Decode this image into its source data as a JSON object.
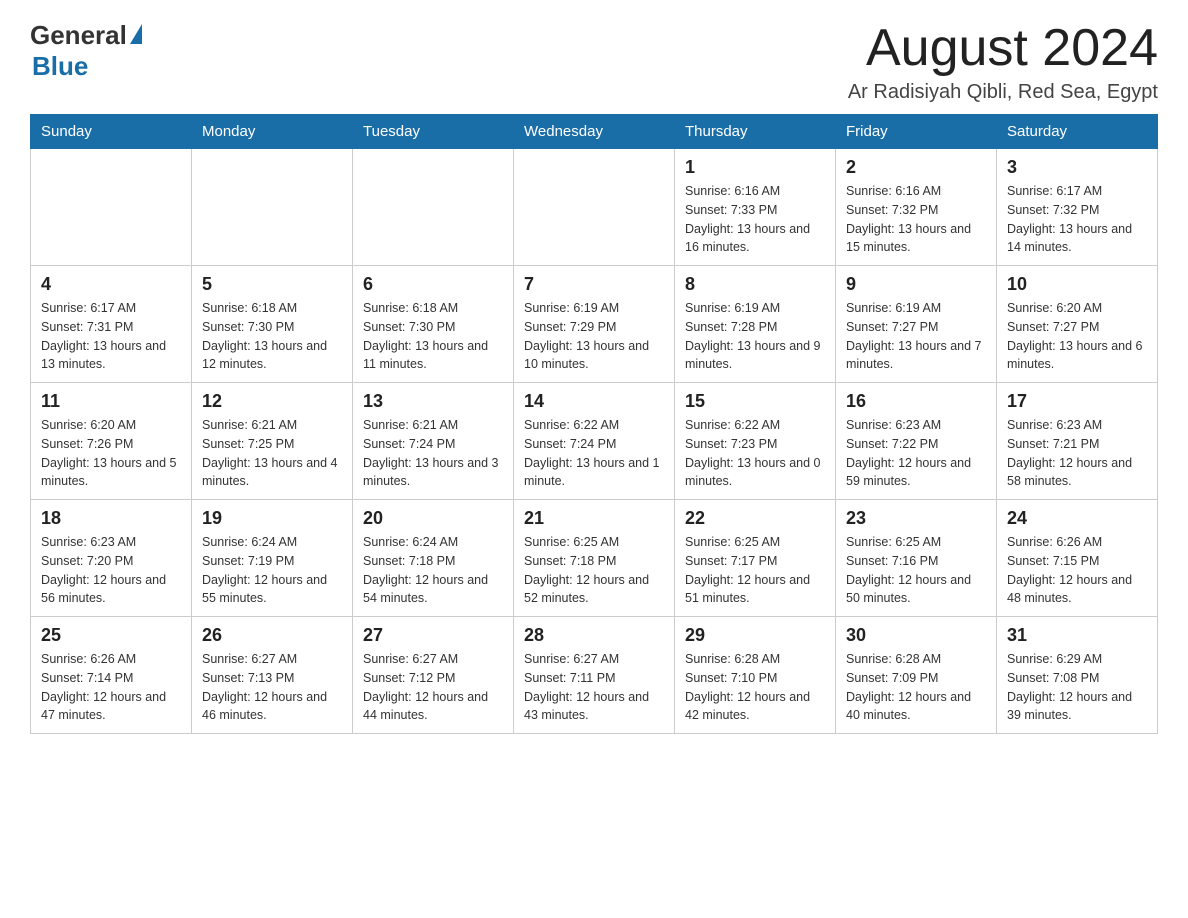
{
  "header": {
    "logo": {
      "general": "General",
      "blue": "Blue"
    },
    "title": "August 2024",
    "location": "Ar Radisiyah Qibli, Red Sea, Egypt"
  },
  "days_of_week": [
    "Sunday",
    "Monday",
    "Tuesday",
    "Wednesday",
    "Thursday",
    "Friday",
    "Saturday"
  ],
  "weeks": [
    [
      {
        "day": "",
        "sunrise": "",
        "sunset": "",
        "daylight": ""
      },
      {
        "day": "",
        "sunrise": "",
        "sunset": "",
        "daylight": ""
      },
      {
        "day": "",
        "sunrise": "",
        "sunset": "",
        "daylight": ""
      },
      {
        "day": "",
        "sunrise": "",
        "sunset": "",
        "daylight": ""
      },
      {
        "day": "1",
        "sunrise": "Sunrise: 6:16 AM",
        "sunset": "Sunset: 7:33 PM",
        "daylight": "Daylight: 13 hours and 16 minutes."
      },
      {
        "day": "2",
        "sunrise": "Sunrise: 6:16 AM",
        "sunset": "Sunset: 7:32 PM",
        "daylight": "Daylight: 13 hours and 15 minutes."
      },
      {
        "day": "3",
        "sunrise": "Sunrise: 6:17 AM",
        "sunset": "Sunset: 7:32 PM",
        "daylight": "Daylight: 13 hours and 14 minutes."
      }
    ],
    [
      {
        "day": "4",
        "sunrise": "Sunrise: 6:17 AM",
        "sunset": "Sunset: 7:31 PM",
        "daylight": "Daylight: 13 hours and 13 minutes."
      },
      {
        "day": "5",
        "sunrise": "Sunrise: 6:18 AM",
        "sunset": "Sunset: 7:30 PM",
        "daylight": "Daylight: 13 hours and 12 minutes."
      },
      {
        "day": "6",
        "sunrise": "Sunrise: 6:18 AM",
        "sunset": "Sunset: 7:30 PM",
        "daylight": "Daylight: 13 hours and 11 minutes."
      },
      {
        "day": "7",
        "sunrise": "Sunrise: 6:19 AM",
        "sunset": "Sunset: 7:29 PM",
        "daylight": "Daylight: 13 hours and 10 minutes."
      },
      {
        "day": "8",
        "sunrise": "Sunrise: 6:19 AM",
        "sunset": "Sunset: 7:28 PM",
        "daylight": "Daylight: 13 hours and 9 minutes."
      },
      {
        "day": "9",
        "sunrise": "Sunrise: 6:19 AM",
        "sunset": "Sunset: 7:27 PM",
        "daylight": "Daylight: 13 hours and 7 minutes."
      },
      {
        "day": "10",
        "sunrise": "Sunrise: 6:20 AM",
        "sunset": "Sunset: 7:27 PM",
        "daylight": "Daylight: 13 hours and 6 minutes."
      }
    ],
    [
      {
        "day": "11",
        "sunrise": "Sunrise: 6:20 AM",
        "sunset": "Sunset: 7:26 PM",
        "daylight": "Daylight: 13 hours and 5 minutes."
      },
      {
        "day": "12",
        "sunrise": "Sunrise: 6:21 AM",
        "sunset": "Sunset: 7:25 PM",
        "daylight": "Daylight: 13 hours and 4 minutes."
      },
      {
        "day": "13",
        "sunrise": "Sunrise: 6:21 AM",
        "sunset": "Sunset: 7:24 PM",
        "daylight": "Daylight: 13 hours and 3 minutes."
      },
      {
        "day": "14",
        "sunrise": "Sunrise: 6:22 AM",
        "sunset": "Sunset: 7:24 PM",
        "daylight": "Daylight: 13 hours and 1 minute."
      },
      {
        "day": "15",
        "sunrise": "Sunrise: 6:22 AM",
        "sunset": "Sunset: 7:23 PM",
        "daylight": "Daylight: 13 hours and 0 minutes."
      },
      {
        "day": "16",
        "sunrise": "Sunrise: 6:23 AM",
        "sunset": "Sunset: 7:22 PM",
        "daylight": "Daylight: 12 hours and 59 minutes."
      },
      {
        "day": "17",
        "sunrise": "Sunrise: 6:23 AM",
        "sunset": "Sunset: 7:21 PM",
        "daylight": "Daylight: 12 hours and 58 minutes."
      }
    ],
    [
      {
        "day": "18",
        "sunrise": "Sunrise: 6:23 AM",
        "sunset": "Sunset: 7:20 PM",
        "daylight": "Daylight: 12 hours and 56 minutes."
      },
      {
        "day": "19",
        "sunrise": "Sunrise: 6:24 AM",
        "sunset": "Sunset: 7:19 PM",
        "daylight": "Daylight: 12 hours and 55 minutes."
      },
      {
        "day": "20",
        "sunrise": "Sunrise: 6:24 AM",
        "sunset": "Sunset: 7:18 PM",
        "daylight": "Daylight: 12 hours and 54 minutes."
      },
      {
        "day": "21",
        "sunrise": "Sunrise: 6:25 AM",
        "sunset": "Sunset: 7:18 PM",
        "daylight": "Daylight: 12 hours and 52 minutes."
      },
      {
        "day": "22",
        "sunrise": "Sunrise: 6:25 AM",
        "sunset": "Sunset: 7:17 PM",
        "daylight": "Daylight: 12 hours and 51 minutes."
      },
      {
        "day": "23",
        "sunrise": "Sunrise: 6:25 AM",
        "sunset": "Sunset: 7:16 PM",
        "daylight": "Daylight: 12 hours and 50 minutes."
      },
      {
        "day": "24",
        "sunrise": "Sunrise: 6:26 AM",
        "sunset": "Sunset: 7:15 PM",
        "daylight": "Daylight: 12 hours and 48 minutes."
      }
    ],
    [
      {
        "day": "25",
        "sunrise": "Sunrise: 6:26 AM",
        "sunset": "Sunset: 7:14 PM",
        "daylight": "Daylight: 12 hours and 47 minutes."
      },
      {
        "day": "26",
        "sunrise": "Sunrise: 6:27 AM",
        "sunset": "Sunset: 7:13 PM",
        "daylight": "Daylight: 12 hours and 46 minutes."
      },
      {
        "day": "27",
        "sunrise": "Sunrise: 6:27 AM",
        "sunset": "Sunset: 7:12 PM",
        "daylight": "Daylight: 12 hours and 44 minutes."
      },
      {
        "day": "28",
        "sunrise": "Sunrise: 6:27 AM",
        "sunset": "Sunset: 7:11 PM",
        "daylight": "Daylight: 12 hours and 43 minutes."
      },
      {
        "day": "29",
        "sunrise": "Sunrise: 6:28 AM",
        "sunset": "Sunset: 7:10 PM",
        "daylight": "Daylight: 12 hours and 42 minutes."
      },
      {
        "day": "30",
        "sunrise": "Sunrise: 6:28 AM",
        "sunset": "Sunset: 7:09 PM",
        "daylight": "Daylight: 12 hours and 40 minutes."
      },
      {
        "day": "31",
        "sunrise": "Sunrise: 6:29 AM",
        "sunset": "Sunset: 7:08 PM",
        "daylight": "Daylight: 12 hours and 39 minutes."
      }
    ]
  ]
}
